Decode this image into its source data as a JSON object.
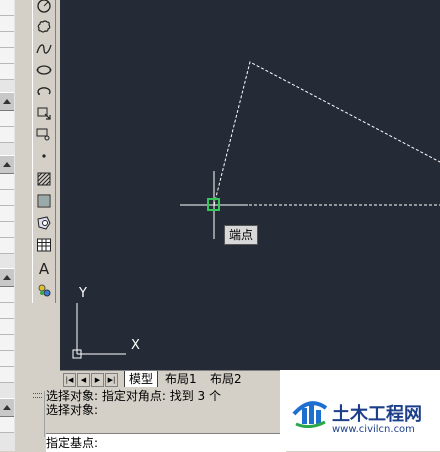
{
  "canvas": {
    "background": "#252b36",
    "tooltip": "端点",
    "ucs_x_label": "X",
    "ucs_y_label": "Y"
  },
  "tabs": [
    {
      "label": "模型",
      "active": true
    },
    {
      "label": "布局1",
      "active": false
    },
    {
      "label": "布局2",
      "active": false
    }
  ],
  "command": {
    "history": [
      "选择对象: 指定对角点: 找到 3 个",
      "选择对象:"
    ],
    "prompt": "指定基点:"
  },
  "toolbar": {
    "tools": [
      "circle-icon",
      "revision-cloud-icon",
      "spline-icon",
      "ellipse-icon",
      "ellipse-arc-icon",
      "insert-block-icon",
      "make-block-icon",
      "point-icon",
      "hatch-icon",
      "gradient-icon",
      "region-icon",
      "table-icon",
      "multiline-text-icon",
      "add-selected-icon"
    ],
    "text_tool_glyph": "A"
  },
  "watermark": {
    "title": "土木工程网",
    "url": "www.civilcn.com"
  }
}
